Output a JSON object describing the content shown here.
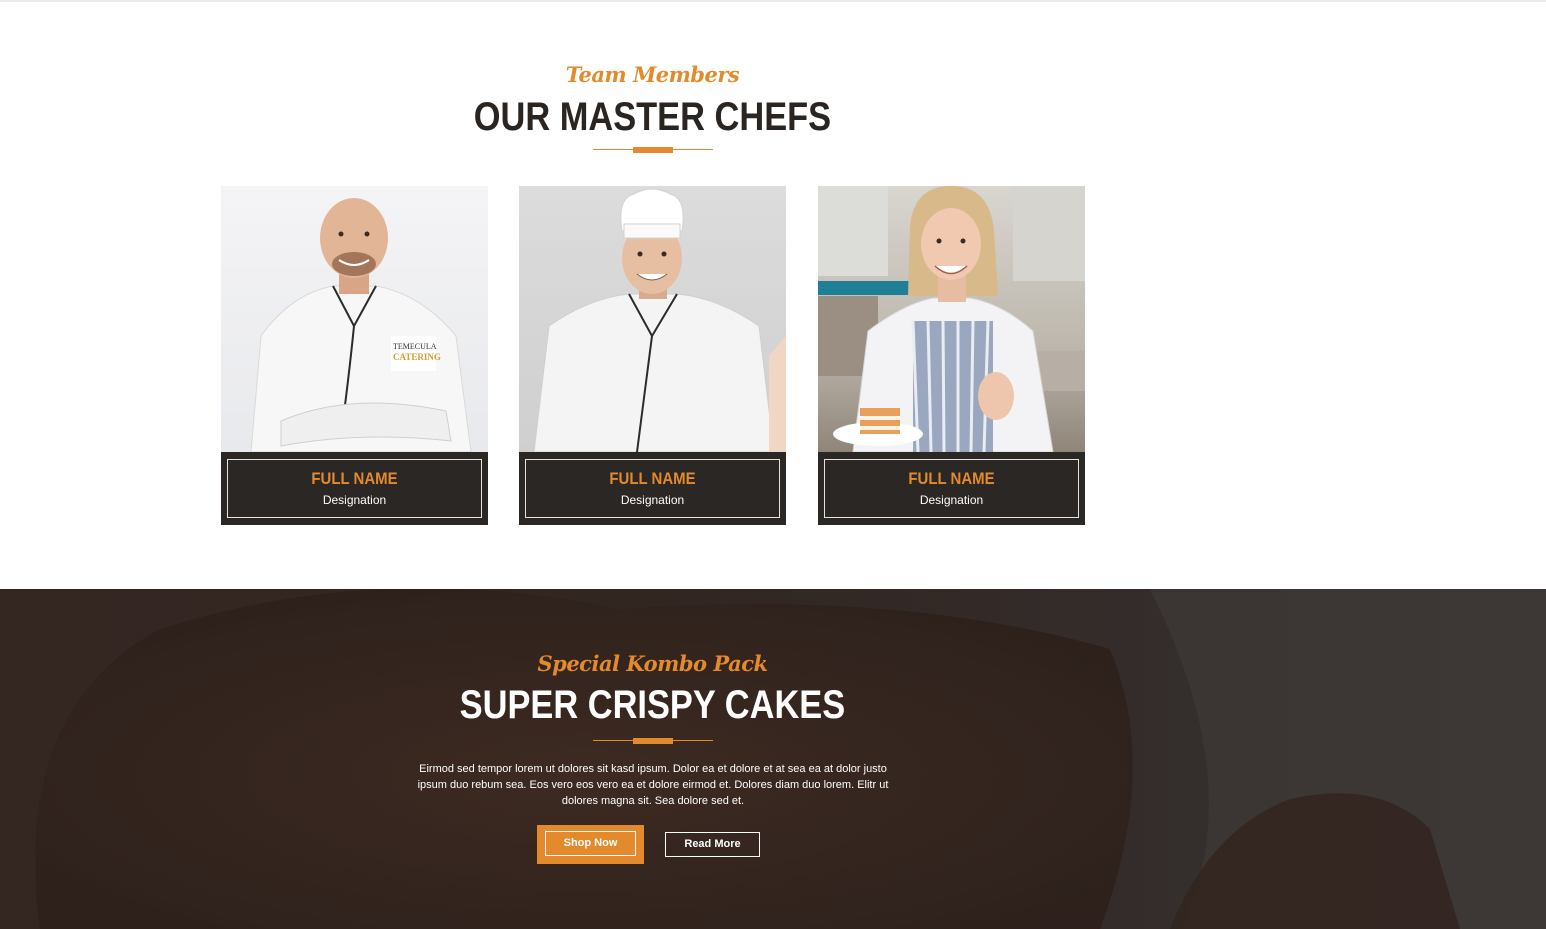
{
  "team": {
    "subtitle": "Team Members",
    "title": "OUR MASTER CHEFS",
    "members": [
      {
        "name": "FULL NAME",
        "designation": "Designation"
      },
      {
        "name": "FULL NAME",
        "designation": "Designation"
      },
      {
        "name": "FULL NAME",
        "designation": "Designation"
      }
    ]
  },
  "promo": {
    "subtitle": "Special Kombo Pack",
    "title": "SUPER CRISPY CAKES",
    "description": "Eirmod sed tempor lorem ut dolores sit kasd ipsum. Dolor ea et dolore et at sea ea at dolor justo ipsum duo rebum sea. Eos vero eos vero ea et dolore eirmod et. Dolores diam duo lorem. Elitr ut dolores magna sit. Sea dolore sed et.",
    "shop_label": "Shop Now",
    "read_label": "Read More"
  },
  "colors": {
    "accent": "#e38a2d",
    "dark": "#2b2724",
    "heading": "#2b2522"
  }
}
